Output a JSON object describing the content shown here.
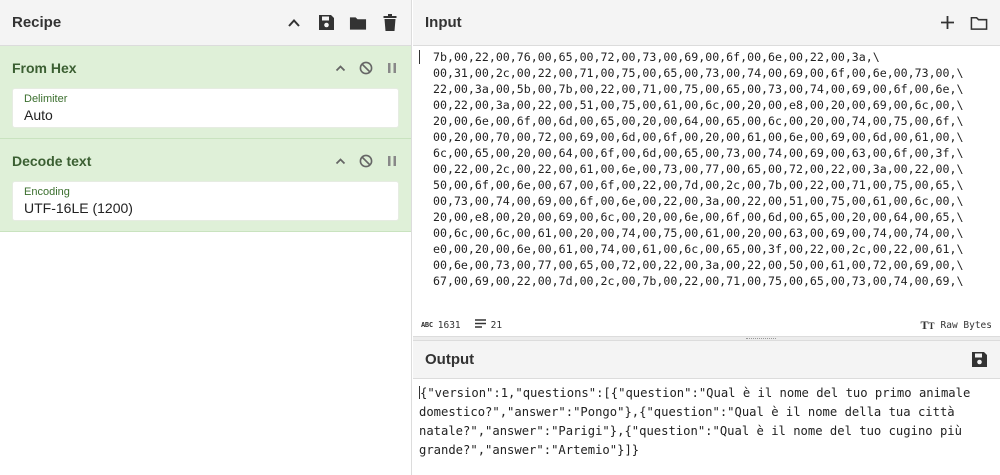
{
  "recipe": {
    "title": "Recipe",
    "icons": [
      "chevron-up-icon",
      "save-icon",
      "folder-icon",
      "trash-icon"
    ],
    "operations": [
      {
        "name": "From Hex",
        "arg_label": "Delimiter",
        "arg_value": "Auto"
      },
      {
        "name": "Decode text",
        "arg_label": "Encoding",
        "arg_value": "UTF-16LE (1200)"
      }
    ]
  },
  "input": {
    "title": "Input",
    "icons": [
      "plus-icon",
      "folder-icon"
    ],
    "lines": [
      "7b,00,22,00,76,00,65,00,72,00,73,00,69,00,6f,00,6e,00,22,00,3a,\\",
      "00,31,00,2c,00,22,00,71,00,75,00,65,00,73,00,74,00,69,00,6f,00,6e,00,73,00,\\",
      "22,00,3a,00,5b,00,7b,00,22,00,71,00,75,00,65,00,73,00,74,00,69,00,6f,00,6e,\\",
      "00,22,00,3a,00,22,00,51,00,75,00,61,00,6c,00,20,00,e8,00,20,00,69,00,6c,00,\\",
      "20,00,6e,00,6f,00,6d,00,65,00,20,00,64,00,65,00,6c,00,20,00,74,00,75,00,6f,\\",
      "00,20,00,70,00,72,00,69,00,6d,00,6f,00,20,00,61,00,6e,00,69,00,6d,00,61,00,\\",
      "6c,00,65,00,20,00,64,00,6f,00,6d,00,65,00,73,00,74,00,69,00,63,00,6f,00,3f,\\",
      "00,22,00,2c,00,22,00,61,00,6e,00,73,00,77,00,65,00,72,00,22,00,3a,00,22,00,\\",
      "50,00,6f,00,6e,00,67,00,6f,00,22,00,7d,00,2c,00,7b,00,22,00,71,00,75,00,65,\\",
      "00,73,00,74,00,69,00,6f,00,6e,00,22,00,3a,00,22,00,51,00,75,00,61,00,6c,00,\\",
      "20,00,e8,00,20,00,69,00,6c,00,20,00,6e,00,6f,00,6d,00,65,00,20,00,64,00,65,\\",
      "00,6c,00,6c,00,61,00,20,00,74,00,75,00,61,00,20,00,63,00,69,00,74,00,74,00,\\",
      "e0,00,20,00,6e,00,61,00,74,00,61,00,6c,00,65,00,3f,00,22,00,2c,00,22,00,61,\\",
      "00,6e,00,73,00,77,00,65,00,72,00,22,00,3a,00,22,00,50,00,61,00,72,00,69,00,\\",
      "67,00,69,00,22,00,7d,00,2c,00,7b,00,22,00,71,00,75,00,65,00,73,00,74,00,69,\\"
    ],
    "status": {
      "length": "1631",
      "lines": "21",
      "raw_bytes_label": "Raw Bytes"
    }
  },
  "output": {
    "title": "Output",
    "icons": [
      "save-icon"
    ],
    "text": "{\"version\":1,\"questions\":[{\"question\":\"Qual è il nome del tuo primo animale domestico?\",\"answer\":\"Pongo\"},{\"question\":\"Qual è il nome della tua città natale?\",\"answer\":\"Parigi\"},{\"question\":\"Qual è il nome del tuo cugino più grande?\",\"answer\":\"Artemio\"}]}"
  }
}
